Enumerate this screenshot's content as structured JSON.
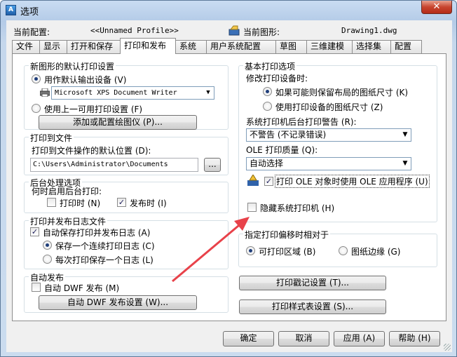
{
  "window": {
    "title": "选项",
    "close": "✕",
    "app_icon_text": "A"
  },
  "header": {
    "profile_label": "当前配置:",
    "profile_value": "<<Unnamed Profile>>",
    "drawing_label": "当前图形:",
    "drawing_value": "Drawing1.dwg"
  },
  "tabs": [
    "文件",
    "显示",
    "打开和保存",
    "打印和发布",
    "系统",
    "用户系统配置",
    "草图",
    "三维建模",
    "选择集",
    "配置"
  ],
  "left": {
    "default_settings": {
      "title": "新图形的默认打印设置",
      "use_default_device": "用作默认输出设备 (V)",
      "device_value": "Microsoft XPS Document Writer",
      "use_last": "使用上一可用打印设置 (F)",
      "add_plotter": "添加或配置绘图仪 (P)..."
    },
    "plot_to_file": {
      "title": "打印到文件",
      "label": "打印到文件操作的默认位置 (D):",
      "path": "C:\\Users\\Administrator\\Documents",
      "browse": "..."
    },
    "background": {
      "title": "后台处理选项",
      "label": "何时启用后台打印:",
      "plotting": "打印时 (N)",
      "publishing": "发布时 (I)"
    },
    "log": {
      "title": "打印并发布日志文件",
      "auto_save": "自动保存打印并发布日志 (A)",
      "continuous": "保存一个连续打印日志 (C)",
      "per_plot": "每次打印保存一个日志 (L)"
    },
    "auto_publish": {
      "title": "自动发布",
      "checkbox": "自动 DWF 发布 (M)",
      "settings_button": "自动 DWF 发布设置 (W)..."
    }
  },
  "right": {
    "general": {
      "title": "基本打印选项",
      "when_changing": "修改打印设备时:",
      "keep_layout": "如果可能则保留布局的图纸尺寸 (K)",
      "use_device": "使用打印设备的图纸尺寸 (Z)",
      "spooler_label": "系统打印机后台打印警告 (R):",
      "spooler_value": "不警告 (不记录错误)",
      "ole_label": "OLE 打印质量 (Q):",
      "ole_value": "自动选择",
      "ole_app": "打印 OLE 对象时使用 OLE 应用程序 (U)",
      "hide_system": "隐藏系统打印机 (H)"
    },
    "offset": {
      "title": "指定打印偏移时相对于",
      "printable_area": "可打印区域 (B)",
      "edge_of_paper": "图纸边缘 (G)"
    },
    "stamp_button": "打印戳记设置 (T)...",
    "style_button": "打印样式表设置 (S)..."
  },
  "footer": {
    "ok": "确定",
    "cancel": "取消",
    "apply": "应用 (A)",
    "help": "帮助 (H)"
  },
  "colors": {
    "arrow": "#e8424a",
    "accent": "#1f3e7a"
  }
}
